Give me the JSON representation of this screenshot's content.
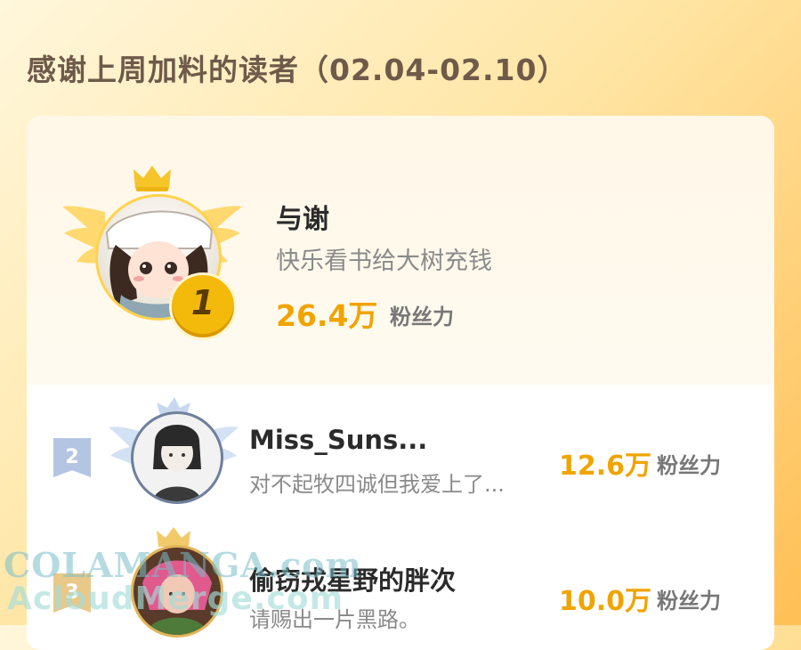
{
  "header": {
    "title": "感谢上周加料的读者（02.04-02.10）"
  },
  "colors": {
    "accent": "#f0a400",
    "rank_badge_gold": "#f3b90b",
    "rank_badge_silver": "#b4c5e3"
  },
  "top_reader": {
    "rank": "1",
    "name": "与谢",
    "message": "快乐看书给大树充钱",
    "value": "26.4万",
    "unit": "粉丝力",
    "icons": [
      "crown-icon",
      "wings-icon"
    ]
  },
  "readers": [
    {
      "rank": "2",
      "name": "Miss_Suns...",
      "message": "对不起牧四诚但我爱上了...",
      "value": "12.6万",
      "unit": "粉丝力"
    },
    {
      "rank": "3",
      "name": "偷窃戎星野的胖次",
      "message": "请赐出一片黑路。",
      "value": "10.0万",
      "unit": "粉丝力"
    }
  ],
  "watermark": {
    "line1": "COLAMANGA.com",
    "line2": "AcloudMerge.com"
  }
}
